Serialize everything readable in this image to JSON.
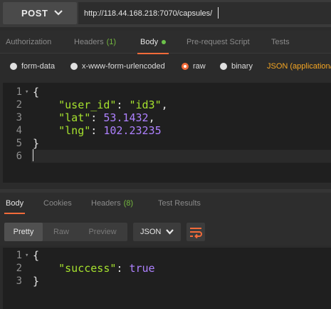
{
  "request": {
    "method": "POST",
    "url": "http://118.44.168.218:7070/capsules/"
  },
  "request_tabs": [
    {
      "label": "Authorization"
    },
    {
      "label": "Headers",
      "count": "(1)"
    },
    {
      "label": "Body"
    },
    {
      "label": "Pre-request Script"
    },
    {
      "label": "Tests"
    }
  ],
  "body_types": {
    "form_data": "form-data",
    "urlencoded": "x-www-form-urlencoded",
    "raw": "raw",
    "binary": "binary",
    "content_type": "JSON (application/"
  },
  "request_body": {
    "line_numbers": [
      "1",
      "2",
      "3",
      "4",
      "5",
      "6"
    ],
    "l1": "{",
    "l2_key": "\"user_id\"",
    "l2_val": "\"id3\"",
    "l3_key": "\"lat\"",
    "l3_val": "53.1432",
    "l4_key": "\"lng\"",
    "l4_val": "102.23235",
    "l5": "}"
  },
  "response_tabs": [
    {
      "label": "Body"
    },
    {
      "label": "Cookies"
    },
    {
      "label": "Headers",
      "count": "(8)"
    },
    {
      "label": "Test Results"
    }
  ],
  "response_toolbar": {
    "pretty": "Pretty",
    "raw": "Raw",
    "preview": "Preview",
    "format": "JSON"
  },
  "response_body": {
    "line_numbers": [
      "1",
      "2",
      "3"
    ],
    "l1": "{",
    "l2_key": "\"success\"",
    "l2_val": "true",
    "l3": "}"
  },
  "colors": {
    "accent": "#f26b3a",
    "count_green": "#74b83e",
    "json_type": "#f5a623",
    "string_green": "#a6e22e",
    "number_purple": "#ae81ff"
  }
}
